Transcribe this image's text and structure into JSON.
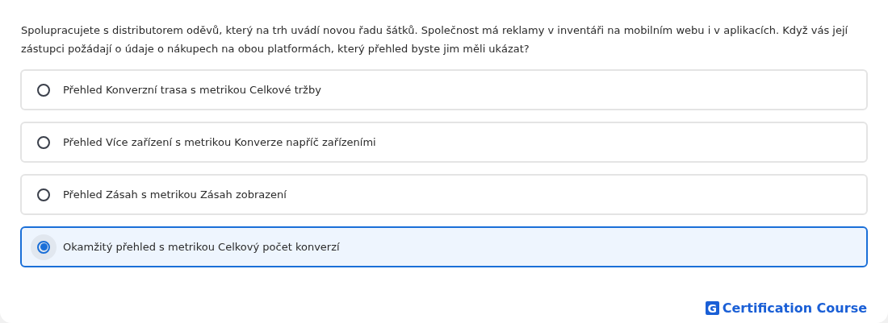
{
  "question": "Spolupracujete s distributorem oděvů, který na trh uvádí novou řadu šátků. Společnost má reklamy v inventáři na mobilním webu i v aplikacích. Když vás její zástupci požádají o údaje o nákupech na obou platformách, který přehled byste jim měli ukázat?",
  "options": [
    {
      "label": "Přehled Konverzní trasa s metrikou Celkové tržby",
      "selected": false
    },
    {
      "label": "Přehled Více zařízení s metrikou Konverze napříč zařízeními",
      "selected": false
    },
    {
      "label": "Přehled Zásah s metrikou Zásah zobrazení",
      "selected": false
    },
    {
      "label": "Okamžitý přehled s metrikou Celkový počet konverzí",
      "selected": true
    }
  ],
  "brand": {
    "logo_letter": "G",
    "name": "Certification Course"
  }
}
